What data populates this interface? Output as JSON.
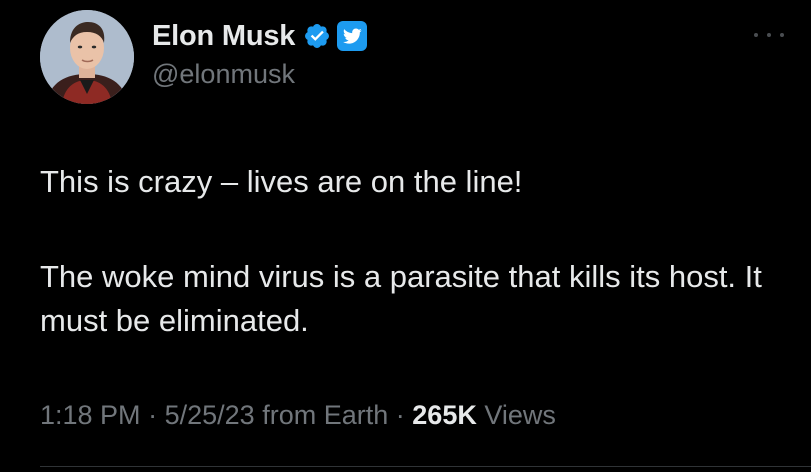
{
  "author": {
    "display_name": "Elon Musk",
    "handle": "@elonmusk",
    "avatar_icon": "avatar-photo",
    "verified_icon": "verified-badge-icon",
    "brand_icon": "twitter-bird-icon"
  },
  "more_icon": "more-options-icon",
  "tweet": {
    "paragraph1": "This is crazy – lives are on the line!",
    "paragraph2": "The woke mind virus is a parasite that kills its host. It must be eliminated."
  },
  "meta": {
    "time": "1:18 PM",
    "sep1": "·",
    "date": "5/25/23",
    "source": "from Earth",
    "sep2": "·",
    "views_count": "265K",
    "views_label": "Views"
  },
  "colors": {
    "background": "#000000",
    "text": "#e7e9ea",
    "muted": "#71767b",
    "accent": "#1d9bf0"
  }
}
